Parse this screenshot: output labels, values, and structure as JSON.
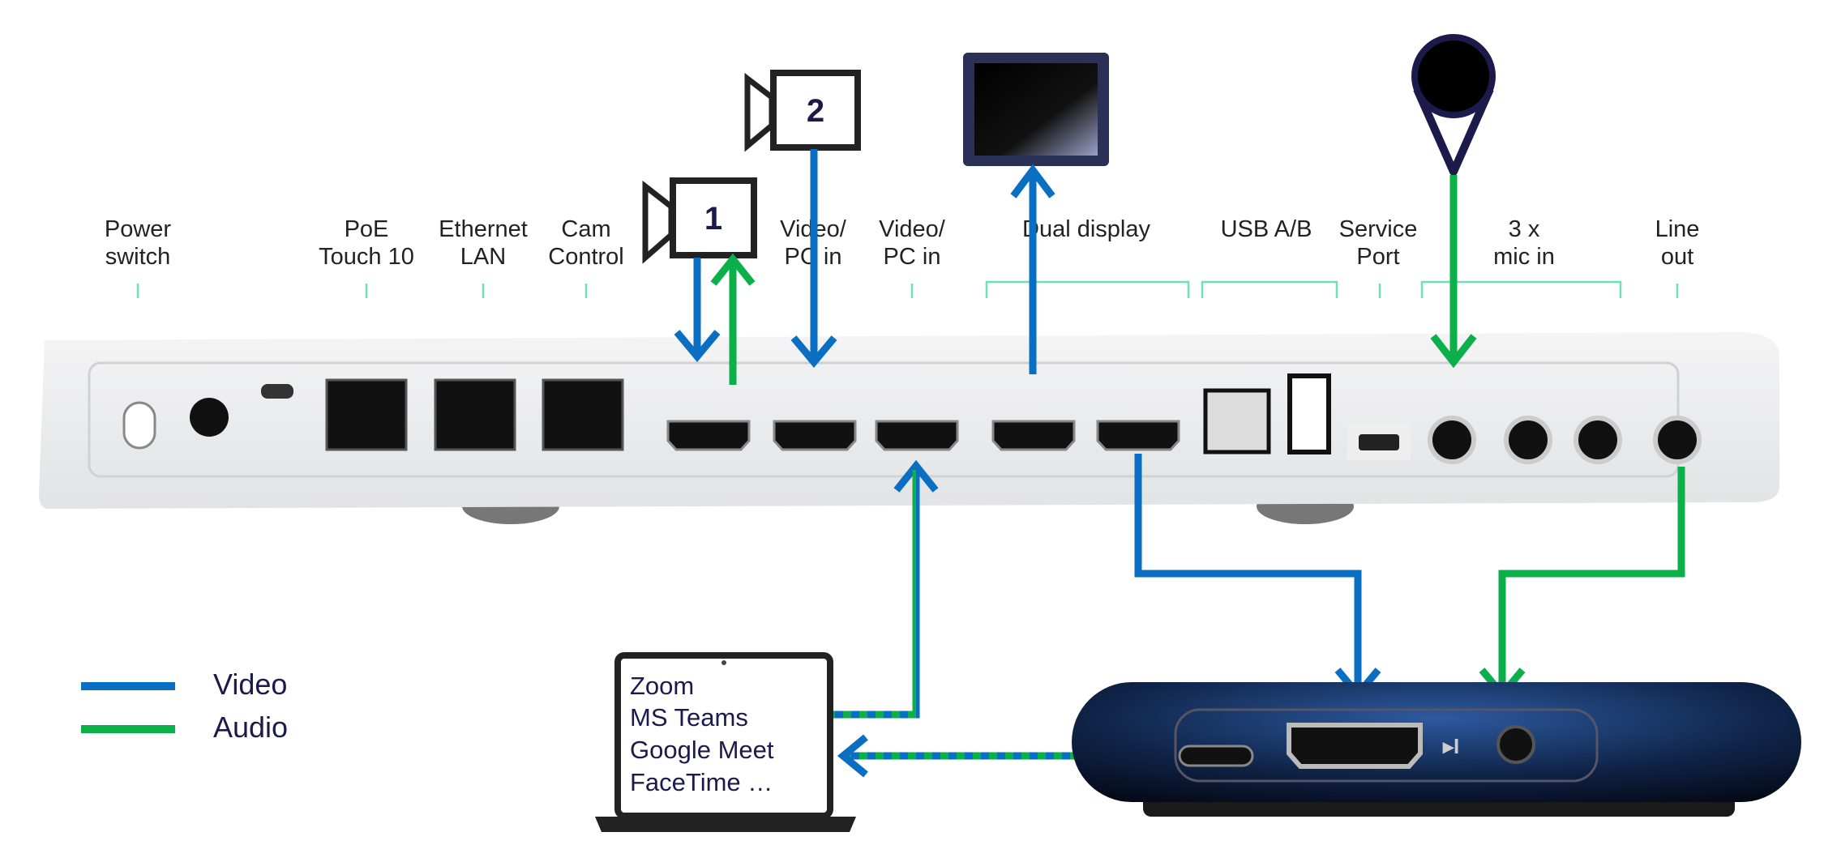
{
  "labels": {
    "power_switch": [
      "Power",
      "switch"
    ],
    "poe_touch": [
      "PoE",
      "Touch 10"
    ],
    "ethernet_lan": [
      "Ethernet",
      "LAN"
    ],
    "cam_control": [
      "Cam",
      "Control"
    ],
    "video_pc_in_2": [
      "Video/",
      "PC in"
    ],
    "video_pc_in_3": [
      "Video/",
      "PC in"
    ],
    "dual_display": "Dual display",
    "usb_ab": "USB A/B",
    "service_port": [
      "Service",
      "Port"
    ],
    "mic_in": [
      "3 x",
      "mic in"
    ],
    "line_out": [
      "Line",
      "out"
    ]
  },
  "cameras": [
    {
      "number": "1"
    },
    {
      "number": "2"
    }
  ],
  "laptop": {
    "apps": [
      "Zoom",
      "MS Teams",
      "Google Meet",
      "FaceTime …"
    ]
  },
  "legend": [
    {
      "label": "Video",
      "color": "#0a6fc2"
    },
    {
      "label": "Audio",
      "color": "#0bb04b"
    }
  ],
  "colors": {
    "video": "#0a6fc2",
    "audio": "#0bb04b",
    "bracket": "#6fe0b8"
  }
}
